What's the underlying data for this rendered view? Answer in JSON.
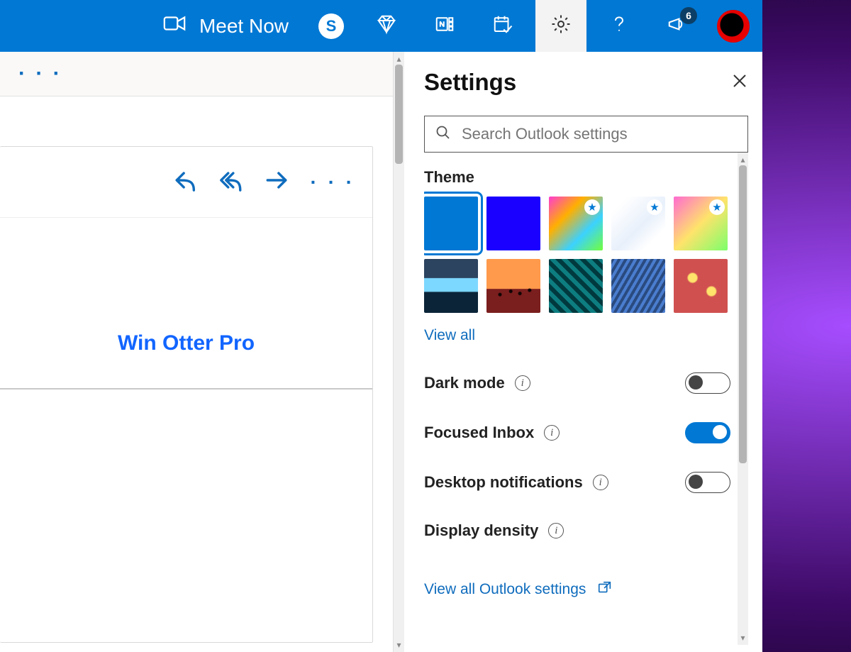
{
  "topbar": {
    "meet_now": "Meet Now",
    "notification_count": "6"
  },
  "commandbar": {
    "ellipsis": "· · ·"
  },
  "reading": {
    "promo_text": "Win Otter Pro",
    "toolbar_ellipsis": "· · ·"
  },
  "settings": {
    "heading": "Settings",
    "search_placeholder": "Search Outlook settings",
    "theme_label": "Theme",
    "themes": [
      {
        "key": "blue",
        "css": "sw-blue",
        "star": false,
        "selected": true
      },
      {
        "key": "blue2",
        "css": "sw-blue2",
        "star": false,
        "selected": false
      },
      {
        "key": "rainbow",
        "css": "sw-rainbow",
        "star": true,
        "selected": false
      },
      {
        "key": "white",
        "css": "sw-white",
        "star": true,
        "selected": false
      },
      {
        "key": "pony",
        "css": "sw-pony",
        "star": true,
        "selected": false
      },
      {
        "key": "wave",
        "css": "sw-wave",
        "star": false,
        "selected": false
      },
      {
        "key": "palm",
        "css": "sw-palm",
        "star": false,
        "selected": false
      },
      {
        "key": "circuit",
        "css": "sw-circuit",
        "star": false,
        "selected": false
      },
      {
        "key": "elev",
        "css": "sw-elev",
        "star": false,
        "selected": false
      },
      {
        "key": "red",
        "css": "sw-red",
        "star": false,
        "selected": false
      }
    ],
    "view_all_themes": "View all",
    "toggles": {
      "dark_mode": {
        "label": "Dark mode",
        "on": false
      },
      "focused_inbox": {
        "label": "Focused Inbox",
        "on": true
      },
      "desktop_notifications": {
        "label": "Desktop notifications",
        "on": false
      }
    },
    "display_density_label": "Display density",
    "view_all_settings": "View all Outlook settings"
  }
}
